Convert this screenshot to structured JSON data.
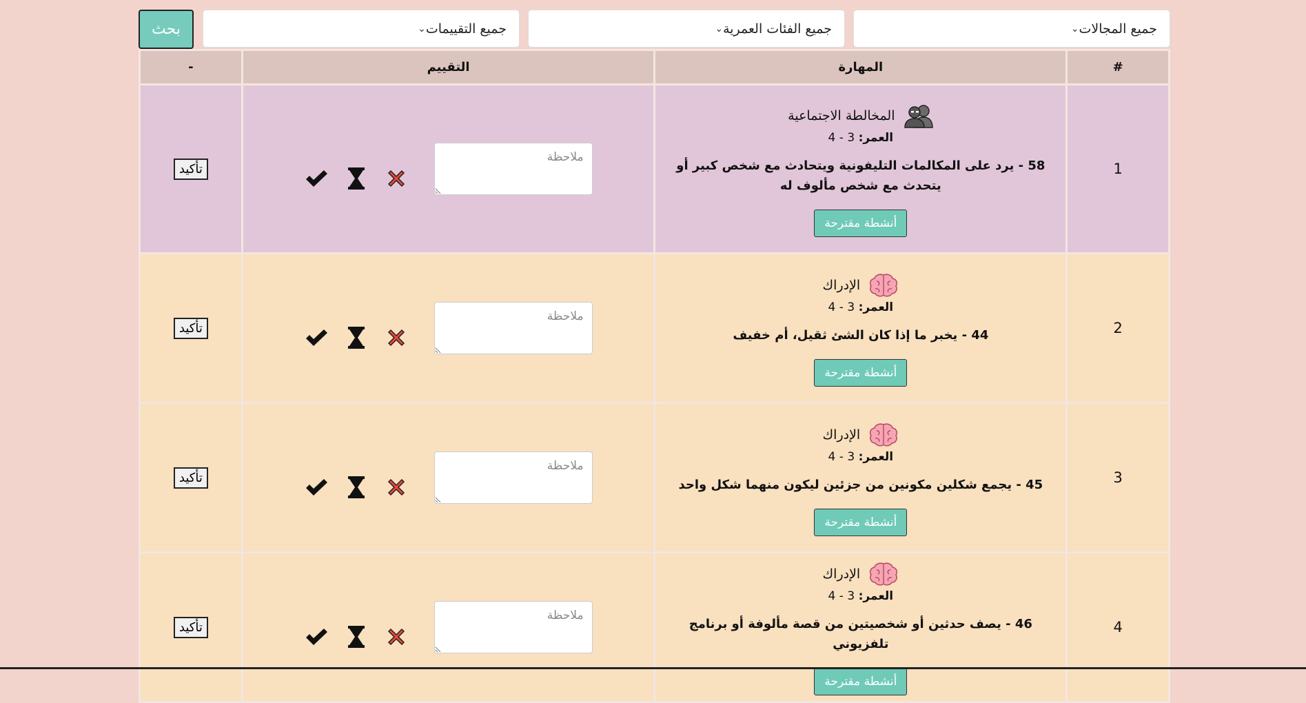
{
  "filters": {
    "domains": "جميع المجالات",
    "ages": "جميع الفئات العمرية",
    "ratings": "جميع التقييمات",
    "search_label": "بحث"
  },
  "table": {
    "headers": [
      "#",
      "المهارة",
      "التقييم",
      "-"
    ],
    "age_label": "العمر:",
    "suggest_label": "أنشطة مقترحة",
    "note_placeholder": "ملاحظة",
    "confirm_label": "تأكيد",
    "rows": [
      {
        "num": "1",
        "domain": "المخالطة الاجتماعية",
        "icon": "people-icon",
        "age": "3 - 4",
        "desc": "58 - يرد على المكالمات التليفونية ويتحادث مع شخص كبير أو يتحدث مع شخص مألوف له"
      },
      {
        "num": "2",
        "domain": "الإدراك",
        "icon": "brain-icon",
        "age": "3 - 4",
        "desc": "44 - يخبر ما إذا كان الشئ ثقيل، أم خفيف"
      },
      {
        "num": "3",
        "domain": "الإدراك",
        "icon": "brain-icon",
        "age": "3 - 4",
        "desc": "45 - يجمع شكلين مكونين من جزئين ليكون منهما شكل واحد"
      },
      {
        "num": "4",
        "domain": "الإدراك",
        "icon": "brain-icon",
        "age": "3 - 4",
        "desc": "46 - يصف حدثين أو شخصيتين من قصة مألوفة أو برنامج تلفزيوني"
      }
    ]
  },
  "colors": {
    "background": "#f2d4cc",
    "header": "#dcc4be",
    "social_row": "#e1c6d9",
    "perception_row": "#f9e0bf",
    "accent": "#76cbbc",
    "cross": "#e8483b"
  }
}
